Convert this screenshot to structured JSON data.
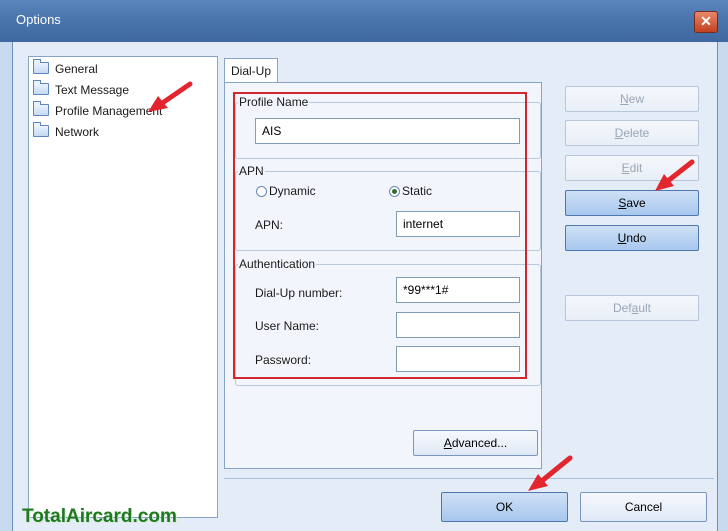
{
  "window": {
    "title": "Options",
    "close_glyph": "✕"
  },
  "tree": {
    "items": [
      "General",
      "Text Message",
      "Profile Management",
      "Network"
    ]
  },
  "tab": {
    "label": "Dial-Up"
  },
  "profile_name": {
    "label": "Profile Name",
    "value": "AIS"
  },
  "apn": {
    "group_label": "APN",
    "dynamic_label": "Dynamic",
    "static_label": "Static",
    "field_label": "APN:",
    "value": "internet"
  },
  "auth": {
    "group_label": "Authentication",
    "dialup_label": "Dial-Up number:",
    "dialup_value": "*99***1#",
    "username_label": "User Name:",
    "username_value": "",
    "password_label": "Password:",
    "password_value": ""
  },
  "buttons": {
    "new_u": "N",
    "new_rest": "ew",
    "delete_u": "D",
    "delete_rest": "elete",
    "edit_u": "E",
    "edit_rest": "dit",
    "save_u": "S",
    "save_rest": "ave",
    "undo_u": "U",
    "undo_rest": "ndo",
    "default_pre": "Def",
    "default_u": "a",
    "default_rest": "ult",
    "advanced_u": "A",
    "advanced_rest": "dvanced...",
    "ok": "OK",
    "cancel": "Cancel"
  },
  "watermark": "TotalAircard.com",
  "colors": {
    "title_bar": "#4a75ad",
    "highlight_box": "#d0262e",
    "arrow": "#e3262e",
    "watermark": "#1f7a1f"
  }
}
